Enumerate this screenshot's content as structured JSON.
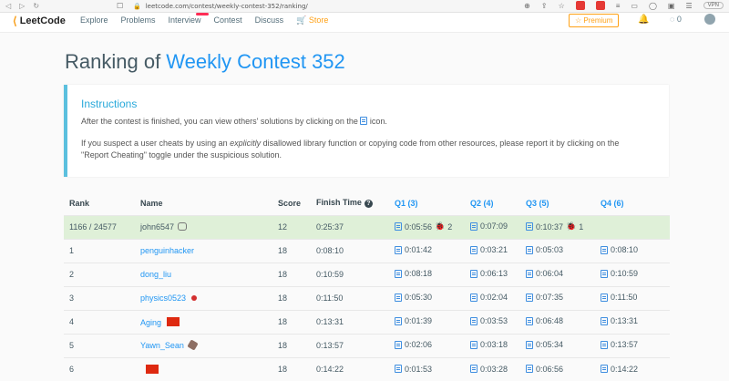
{
  "browser": {
    "url": "leetcode.com/contest/weekly-contest-352/ranking/",
    "vpn": "VPN"
  },
  "nav": {
    "logo": "LeetCode",
    "items": [
      "Explore",
      "Problems",
      "Interview",
      "Contest",
      "Discuss",
      "Store"
    ],
    "premium": "Premium",
    "coins": "0"
  },
  "page": {
    "title_prefix": "Ranking of ",
    "title_contest": "Weekly Contest 352"
  },
  "instructions": {
    "heading": "Instructions",
    "p1_before": "After the contest is finished, you can view others' solutions by clicking on the ",
    "p1_after": " icon.",
    "p2_a": "If you suspect a user cheats by using an ",
    "p2_em": "explicitly",
    "p2_b": " disallowed library function or copying code from other resources, please report it by clicking on the \"Report Cheating\" toggle under the suspicious solution."
  },
  "table": {
    "headers": {
      "rank": "Rank",
      "name": "Name",
      "score": "Score",
      "finish": "Finish Time",
      "q1": "Q1 (3)",
      "q2": "Q2 (4)",
      "q3": "Q3 (5)",
      "q4": "Q4 (6)"
    },
    "me": {
      "rank": "1166 / 24577",
      "name": "john6547",
      "score": "12",
      "finish": "0:25:37",
      "q1": "0:05:56",
      "q1_bugs": "2",
      "q2": "0:07:09",
      "q3": "0:10:37",
      "q3_bugs": "1"
    },
    "rows": [
      {
        "rank": "1",
        "name": "penguinhacker",
        "score": "18",
        "finish": "0:08:10",
        "q1": "0:01:42",
        "q2": "0:03:21",
        "q3": "0:05:03",
        "q4": "0:08:10"
      },
      {
        "rank": "2",
        "name": "dong_liu",
        "score": "18",
        "finish": "0:10:59",
        "q1": "0:08:18",
        "q2": "0:06:13",
        "q3": "0:06:04",
        "q4": "0:10:59"
      },
      {
        "rank": "3",
        "name": "physics0523",
        "score": "18",
        "finish": "0:11:50",
        "q1": "0:05:30",
        "q2": "0:02:04",
        "q3": "0:07:35",
        "q4": "0:11:50"
      },
      {
        "rank": "4",
        "name": "Aging",
        "score": "18",
        "finish": "0:13:31",
        "q1": "0:01:39",
        "q2": "0:03:53",
        "q3": "0:06:48",
        "q4": "0:13:31"
      },
      {
        "rank": "5",
        "name": "Yawn_Sean",
        "score": "18",
        "finish": "0:13:57",
        "q1": "0:02:06",
        "q2": "0:03:18",
        "q3": "0:05:34",
        "q4": "0:13:57"
      },
      {
        "rank": "6",
        "name": "",
        "score": "18",
        "finish": "0:14:22",
        "q1": "0:01:53",
        "q2": "0:03:28",
        "q3": "0:06:56",
        "q4": "0:14:22"
      }
    ]
  }
}
